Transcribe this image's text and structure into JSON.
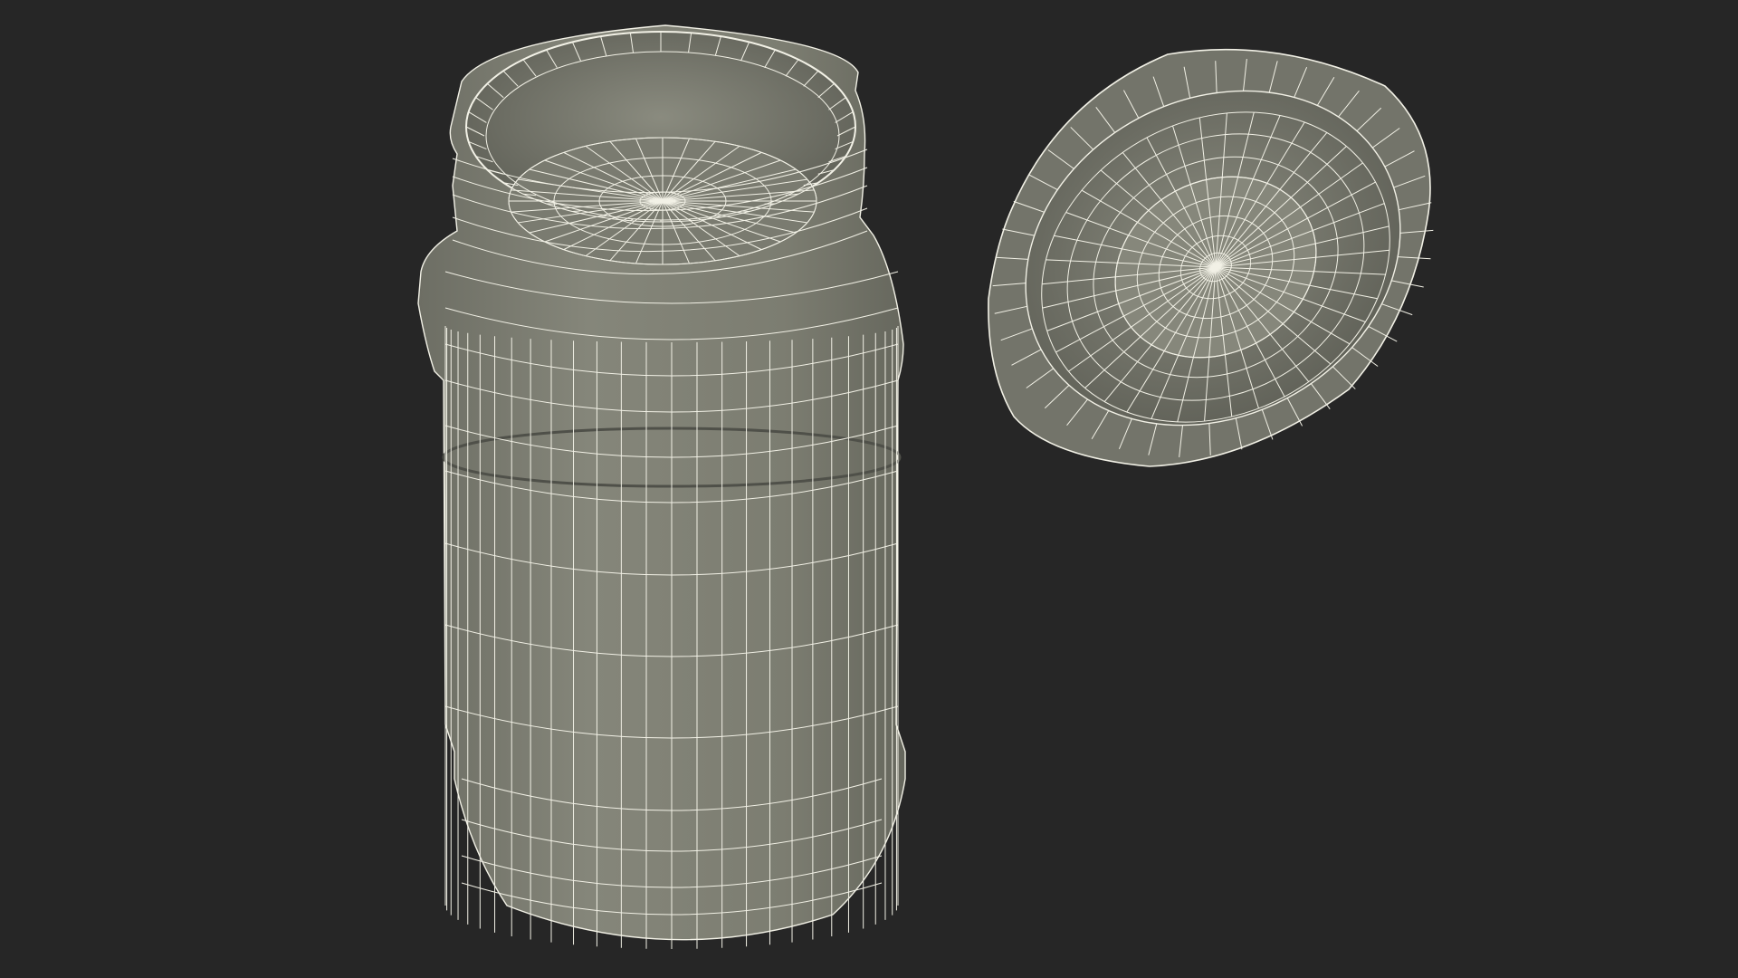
{
  "colors": {
    "background": "#262626",
    "surface": "#7d7e72",
    "surface_dark": "#5f6057",
    "surface_light": "#8f9085",
    "wire": "#f2f1e6"
  },
  "scene": {
    "objects": [
      {
        "name": "jar",
        "description_icon": "cylinder-jar-wireframe"
      },
      {
        "name": "lid",
        "description_icon": "round-lid-wireframe"
      }
    ]
  }
}
